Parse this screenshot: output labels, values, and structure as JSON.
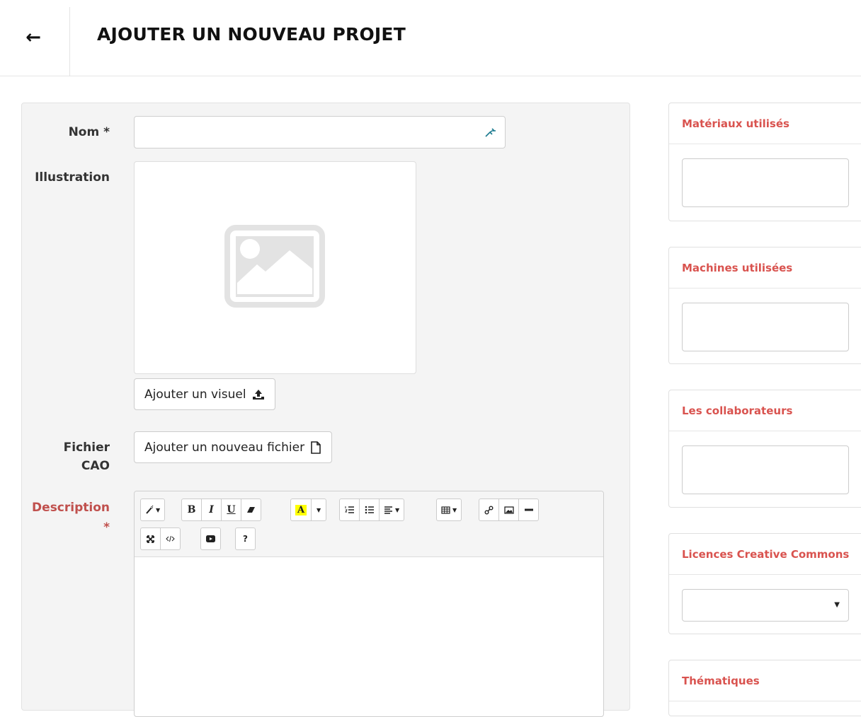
{
  "header": {
    "back_icon": "arrow-left-icon",
    "back_glyph": "←",
    "title": "AJOUTER UN NOUVEAU PROJET"
  },
  "form": {
    "nom_label": "Nom *",
    "nom_value": "",
    "illustration_label": "Illustration",
    "add_visual_button": "Ajouter un visuel",
    "cad_label_line1": "Fichier",
    "cad_label_line2": "CAO",
    "add_file_button": "Ajouter un nouveau fichier",
    "description_label": "Description",
    "description_required": "*"
  },
  "editor_toolbar": {
    "row1": [
      [
        "magic-wand-icon"
      ],
      [
        "bold-icon",
        "italic-icon",
        "underline-icon",
        "eraser-icon"
      ],
      [
        "font-color-icon",
        "font-color-dropdown-icon"
      ],
      [
        "ordered-list-icon",
        "unordered-list-icon",
        "align-icon"
      ],
      [
        "table-icon"
      ],
      [
        "link-icon",
        "image-icon",
        "horizontal-rule-icon"
      ]
    ],
    "row2": [
      [
        "fullscreen-icon",
        "code-view-icon"
      ],
      [
        "video-icon"
      ],
      [
        "help-icon"
      ]
    ]
  },
  "sidebar": {
    "materials_title": "Matériaux utilisés",
    "machines_title": "Machines utilisées",
    "collaborators_title": "Les collaborateurs",
    "licences_title": "Licences Creative Commons",
    "licences_selected": "",
    "themes_title": "Thématiques"
  },
  "colors": {
    "accent_red": "#d9534f",
    "label_red": "#c0504d",
    "panel_bg": "#f4f4f4"
  }
}
